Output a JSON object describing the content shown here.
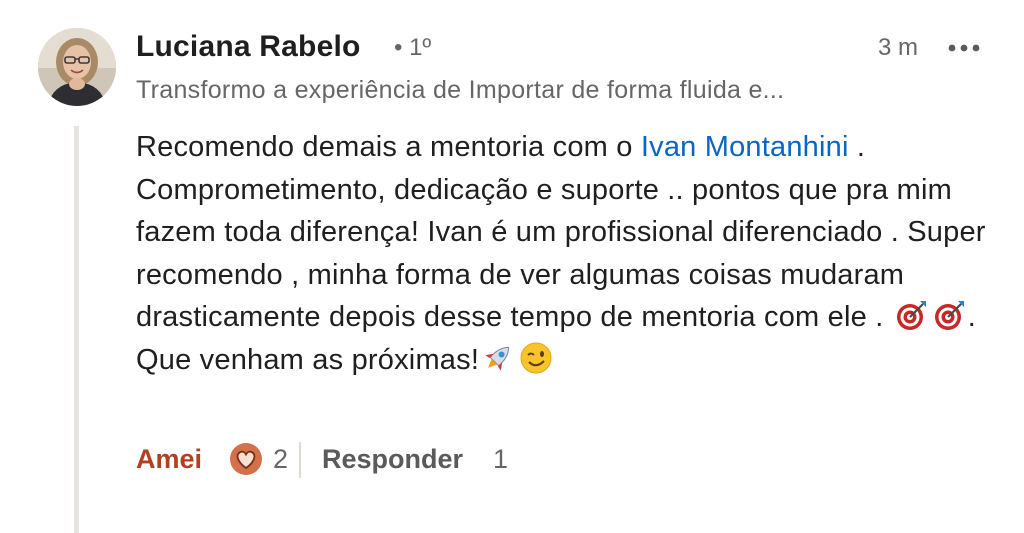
{
  "author": {
    "name": "Luciana Rabelo",
    "degree": "• 1º",
    "headline": "Transformo a experiência de Importar de forma fluida e..."
  },
  "meta": {
    "time": "3 m",
    "more_icon": "more-horizontal-icon"
  },
  "comment": {
    "part1": "Recomendo demais a mentoria com o ",
    "mention": "Ivan Montanhini",
    "part2": " . Comprometimento, dedicação e suporte .. pontos que pra mim fazem toda diferença! Ivan é um profissional diferenciado . Super recomendo , minha forma de ver algumas coisas mudaram drasticamente depois desse tempo de mentoria com ele . ",
    "part3": ". Que venham as próximas!"
  },
  "actions": {
    "like_label": "Amei",
    "reaction_icon": "heart-reaction-icon",
    "reaction_count": "2",
    "reply_label": "Responder",
    "reply_count": "1"
  },
  "colors": {
    "mention": "#0a66c2",
    "like_active": "#b24020",
    "secondary_text": "#666666",
    "thread_line": "#e6e4df"
  }
}
